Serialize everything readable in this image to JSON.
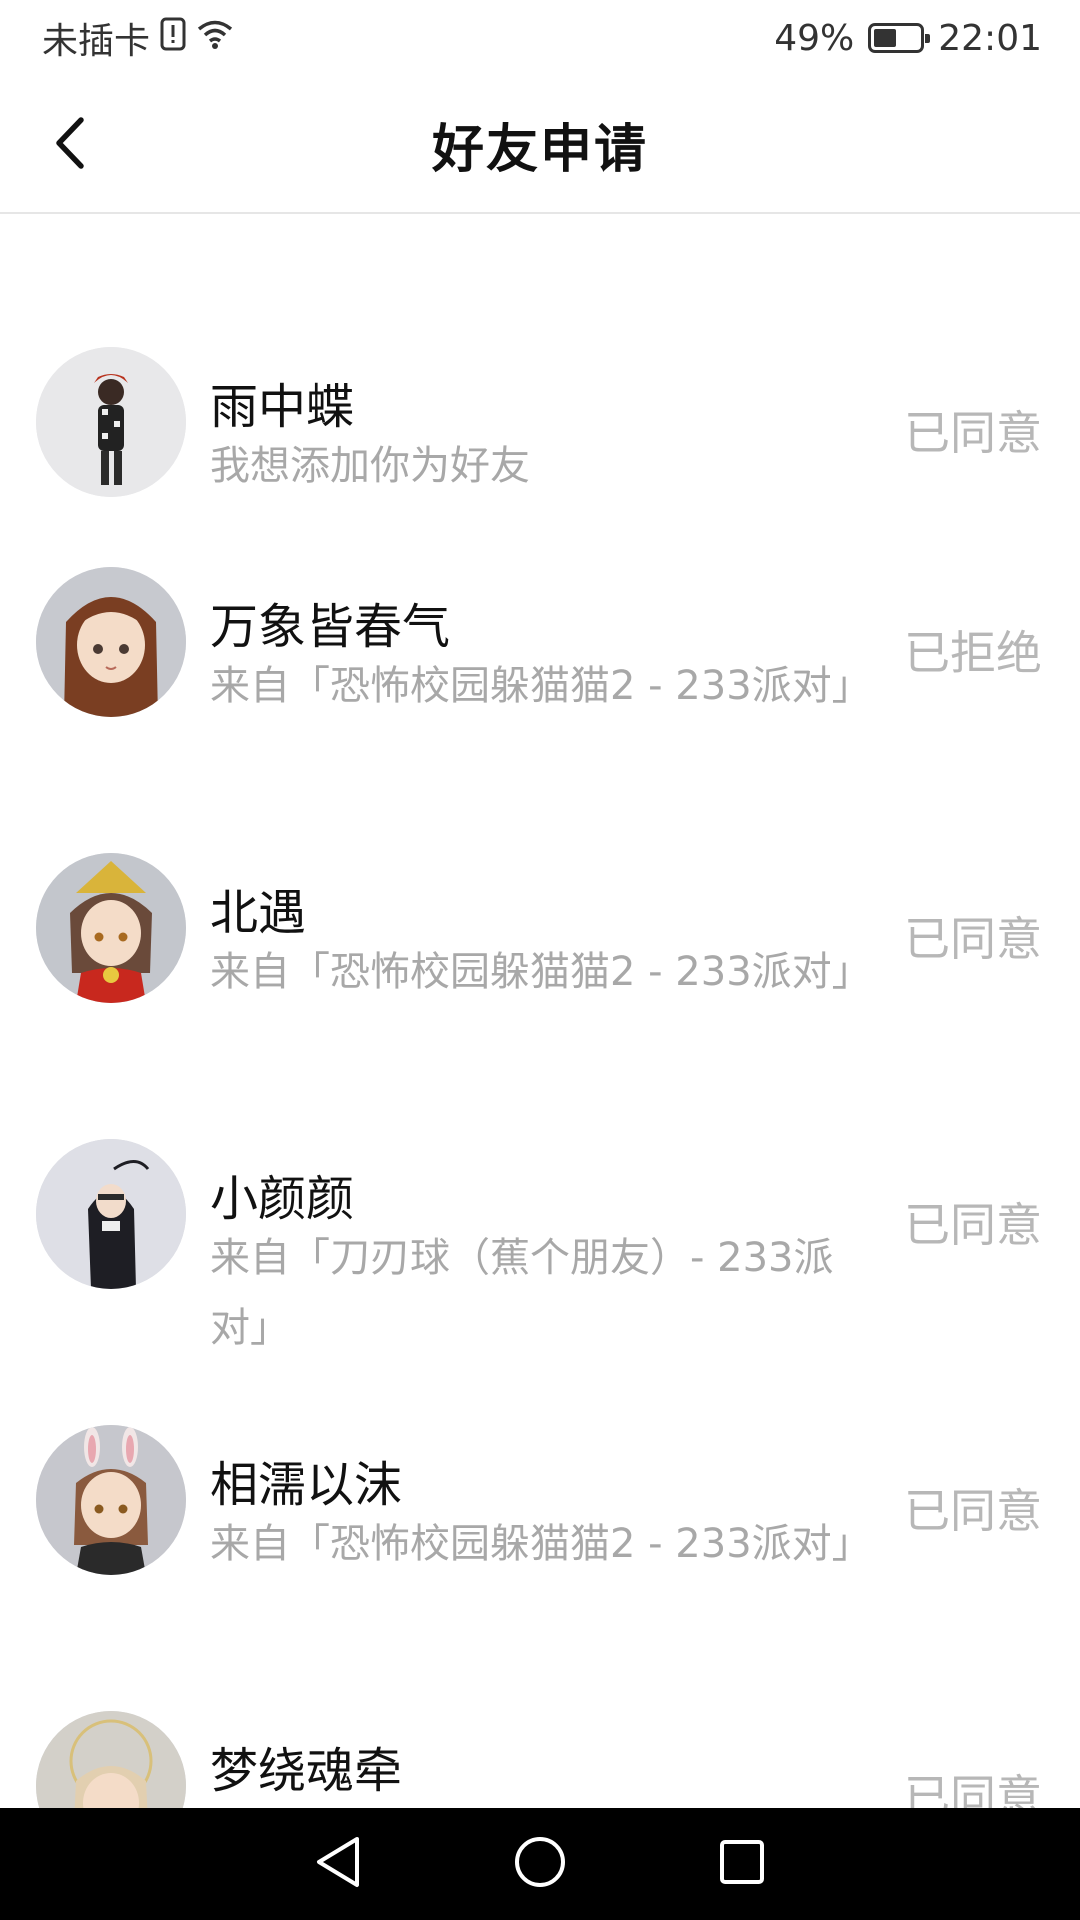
{
  "status_bar": {
    "carrier": "未插卡",
    "battery_percent": "49%",
    "battery_level": 0.49,
    "time": "22:01"
  },
  "nav": {
    "title": "好友申请"
  },
  "requests": [
    {
      "name": "",
      "message": "对」",
      "status": ""
    },
    {
      "name": "雨中蝶",
      "message": "我想添加你为好友",
      "status": "已同意"
    },
    {
      "name": "万象皆春气",
      "message": "来自「恐怖校园躲猫猫2 - 233派对」",
      "status": "已拒绝"
    },
    {
      "name": "北遇",
      "message": "来自「恐怖校园躲猫猫2 - 233派对」",
      "status": "已同意"
    },
    {
      "name": "小颜颜",
      "message": "来自「刀刃球（蕉个朋友）- 233派对」",
      "status": "已同意"
    },
    {
      "name": "相濡以沫",
      "message": "来自「恐怖校园躲猫猫2 - 233派对」",
      "status": "已同意"
    },
    {
      "name": "梦绕魂牵",
      "message": "",
      "status": "已同意"
    }
  ],
  "colors": {
    "name_text": "#111111",
    "secondary_text": "#a8a8a8",
    "status_text": "#b7b7b7",
    "divider": "#e6e6e6",
    "system_nav_bg": "#000000"
  }
}
